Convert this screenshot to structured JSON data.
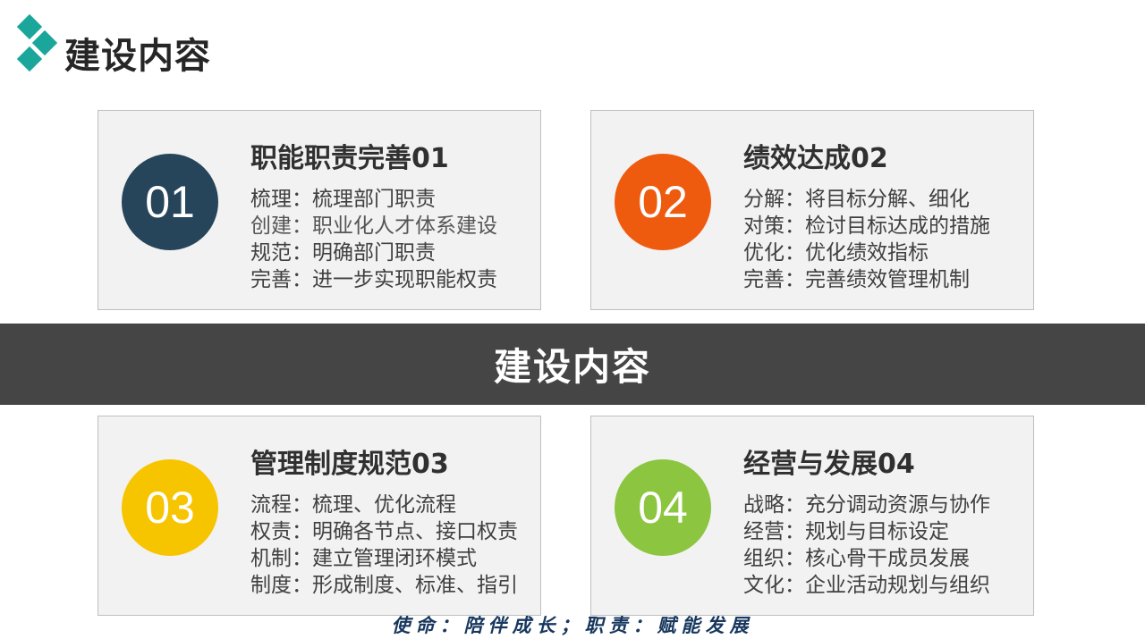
{
  "header": {
    "title": "建设内容",
    "logo_icon": "teal-diamond-logo-icon",
    "logo_color": "#1aa69a"
  },
  "center_band": {
    "text": "建设内容",
    "color": "#454545"
  },
  "cards": [
    {
      "number": "01",
      "color": "#26455a",
      "title": "职能职责完善01",
      "lines": [
        "梳理：梳理部门职责",
        "创建：职业化人才体系建设",
        "规范：明确部门职责",
        "完善：进一步实现职能权责"
      ]
    },
    {
      "number": "02",
      "color": "#ee5b0f",
      "title": "绩效达成02",
      "lines": [
        "分解：将目标分解、细化",
        "对策：检讨目标达成的措施",
        "优化：优化绩效指标",
        "完善：完善绩效管理机制"
      ]
    },
    {
      "number": "03",
      "color": "#f7c400",
      "title": "管理制度规范03",
      "lines": [
        "流程：梳理、优化流程",
        "权责：明确各节点、接口权责",
        "机制：建立管理闭环模式",
        "制度：形成制度、标准、指引"
      ]
    },
    {
      "number": "04",
      "color": "#8cc540",
      "title": "经营与发展04",
      "lines": [
        "战略：充分调动资源与协作",
        "经营：规划与目标设定",
        "组织：核心骨干成员发展",
        "文化：企业活动规划与组织"
      ]
    }
  ],
  "footer": {
    "text": "使命：陪伴成长；职责：赋能发展",
    "color": "#17375e"
  }
}
